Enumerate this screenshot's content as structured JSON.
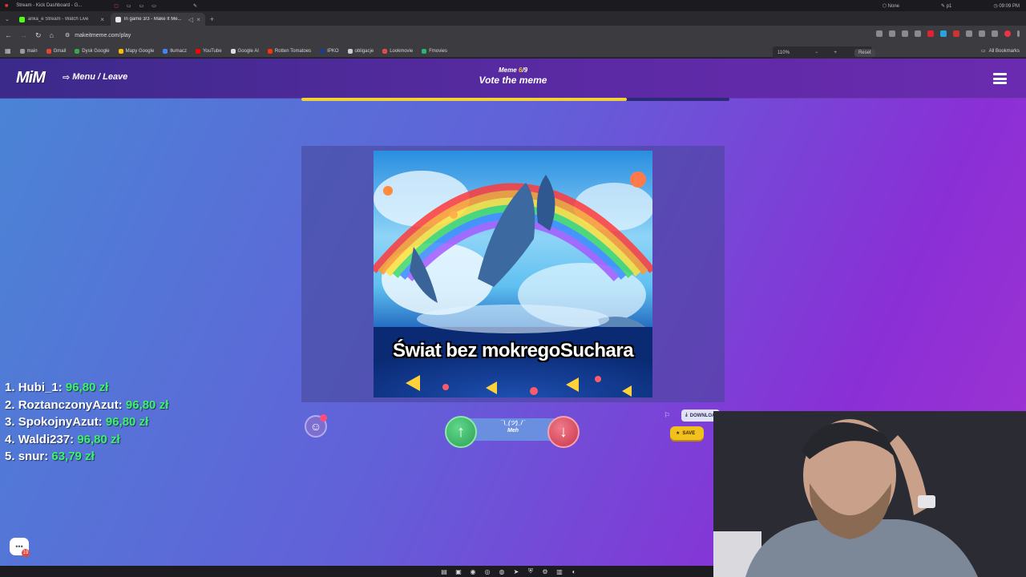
{
  "os_bar": {
    "title": "Stream - Kick Dashboard - G...",
    "status_none": "None",
    "status_p1": "p1",
    "time": "09:09 PM"
  },
  "tabs": [
    {
      "label": "anka_e Stream - Watch Live",
      "color": "#53fc18"
    },
    {
      "label": "In game 3/3 - Make It Me...",
      "color": "#e8e8e8"
    }
  ],
  "address": {
    "url": "makeitmeme.com/play"
  },
  "bookmarks": [
    {
      "label": "main",
      "color": "#9a9aa0"
    },
    {
      "label": "Gmail",
      "color": "#ea4335"
    },
    {
      "label": "Dysk Google",
      "color": "#34a853"
    },
    {
      "label": "Mapy Google",
      "color": "#fbbc05"
    },
    {
      "label": "tłumacz",
      "color": "#4285f4"
    },
    {
      "label": "YouTube",
      "color": "#ff0000"
    },
    {
      "label": "Google AI",
      "color": "#dddddd"
    },
    {
      "label": "Rotten Tomatoes",
      "color": "#fa320a"
    },
    {
      "label": "IPKO",
      "color": "#1a3c8c"
    },
    {
      "label": "obligacje",
      "color": "#cccccc"
    },
    {
      "label": "Lookmovie",
      "color": "#e04b4b"
    },
    {
      "label": "Fmovies",
      "color": "#2bb673"
    }
  ],
  "zoom": {
    "level": "110%",
    "minus": "−",
    "plus": "+",
    "reset": "Reset"
  },
  "all_bookmarks": "All Bookmarks",
  "app": {
    "logo": "MiM",
    "menu_label": "Menu / Leave",
    "meme_label": "Meme",
    "meme_index": "6",
    "meme_total": "/9",
    "phase_title": "Vote the meme",
    "progress": 0.76
  },
  "meme": {
    "caption": "Świat bez mokregoSuchara"
  },
  "vote": {
    "meh_face": "¯\\_(ツ)_/¯",
    "meh_label": "Meh",
    "up_symbol": "↑",
    "down_symbol": "↓"
  },
  "actions": {
    "download_label": "DOWNLOAD",
    "save_label": "SAVE"
  },
  "leaderboard": [
    {
      "rank": "1.",
      "name": "Hubi_1:",
      "amount": "96,80 zł"
    },
    {
      "rank": "2.",
      "name": "RoztanczonyAzut:",
      "amount": "96,80 zł"
    },
    {
      "rank": "3.",
      "name": "SpokojnyAzut:",
      "amount": "96,80 zł"
    },
    {
      "rank": "4.",
      "name": "Waldi237:",
      "amount": "96,80 zł"
    },
    {
      "rank": "5.",
      "name": "snur:",
      "amount": "63,79 zł"
    }
  ],
  "chat_badge": "19",
  "colors": {
    "accent_yellow": "#f2c21a",
    "leader_amount": "#3cf36a",
    "upvote": "#2f9f57",
    "downvote": "#c8354b"
  }
}
